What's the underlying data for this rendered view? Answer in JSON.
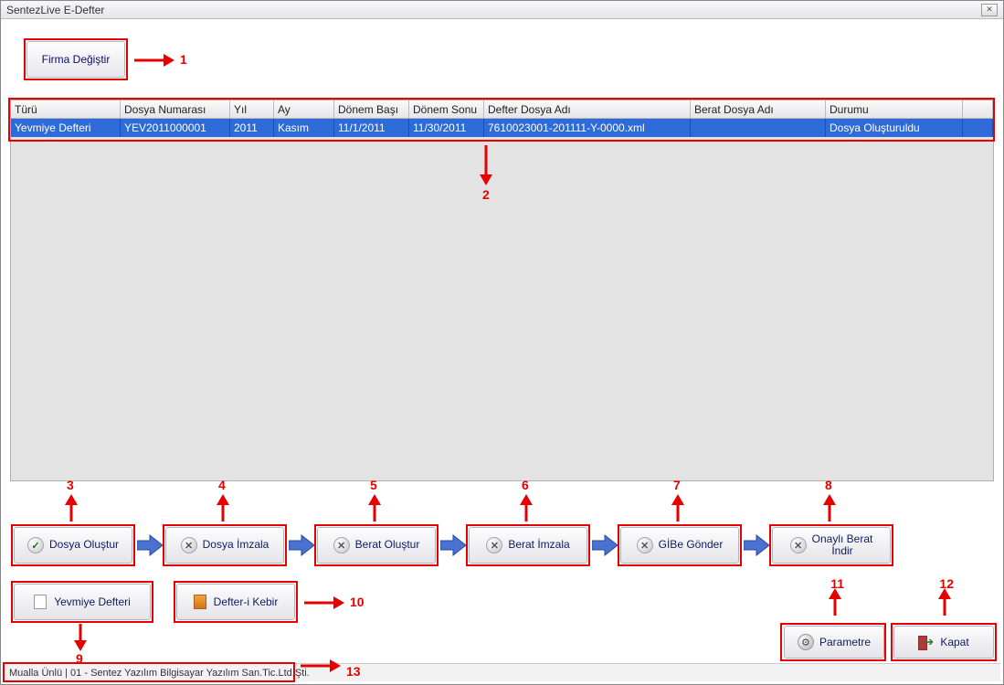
{
  "window": {
    "title": "SentezLive E-Defter"
  },
  "buttons": {
    "changeCompany": "Firma Değiştir",
    "dosyaOlustur": "Dosya Oluştur",
    "dosyaImzala": "Dosya İmzala",
    "beratOlustur": "Berat Oluştur",
    "beratImzala": "Berat İmzala",
    "gibeGonder": "GİBe Gönder",
    "onayliBeratLine1": "Onaylı Berat",
    "onayliBeratLine2": "İndir",
    "yevmiyeDefteri": "Yevmiye Defteri",
    "defteriKebir": "Defter-i Kebir",
    "parametre": "Parametre",
    "kapat": "Kapat"
  },
  "grid": {
    "headers": {
      "turu": "Türü",
      "dosyaNo": "Dosya Numarası",
      "yil": "Yıl",
      "ay": "Ay",
      "donemBasi": "Dönem Başı",
      "donemSonu": "Dönem Sonu",
      "defterDosyaAdi": "Defter Dosya Adı",
      "beratDosyaAdi": "Berat Dosya Adı",
      "durumu": "Durumu"
    },
    "row": {
      "turu": "Yevmiye Defteri",
      "dosyaNo": "YEV2011000001",
      "yil": "2011",
      "ay": "Kasım",
      "donemBasi": "11/1/2011",
      "donemSonu": "11/30/2011",
      "defterDosyaAdi": "7610023001-201111-Y-0000.xml",
      "beratDosyaAdi": "",
      "durumu": "Dosya Oluşturuldu"
    }
  },
  "statusbar": "Mualla Ünlü | 01 - Sentez Yazılım Bilgisayar Yazılım San.Tic.Ltd.Şti.",
  "annotations": {
    "n1": "1",
    "n2": "2",
    "n3": "3",
    "n4": "4",
    "n5": "5",
    "n6": "6",
    "n7": "7",
    "n8": "8",
    "n9": "9",
    "n10": "10",
    "n11": "11",
    "n12": "12",
    "n13": "13"
  }
}
